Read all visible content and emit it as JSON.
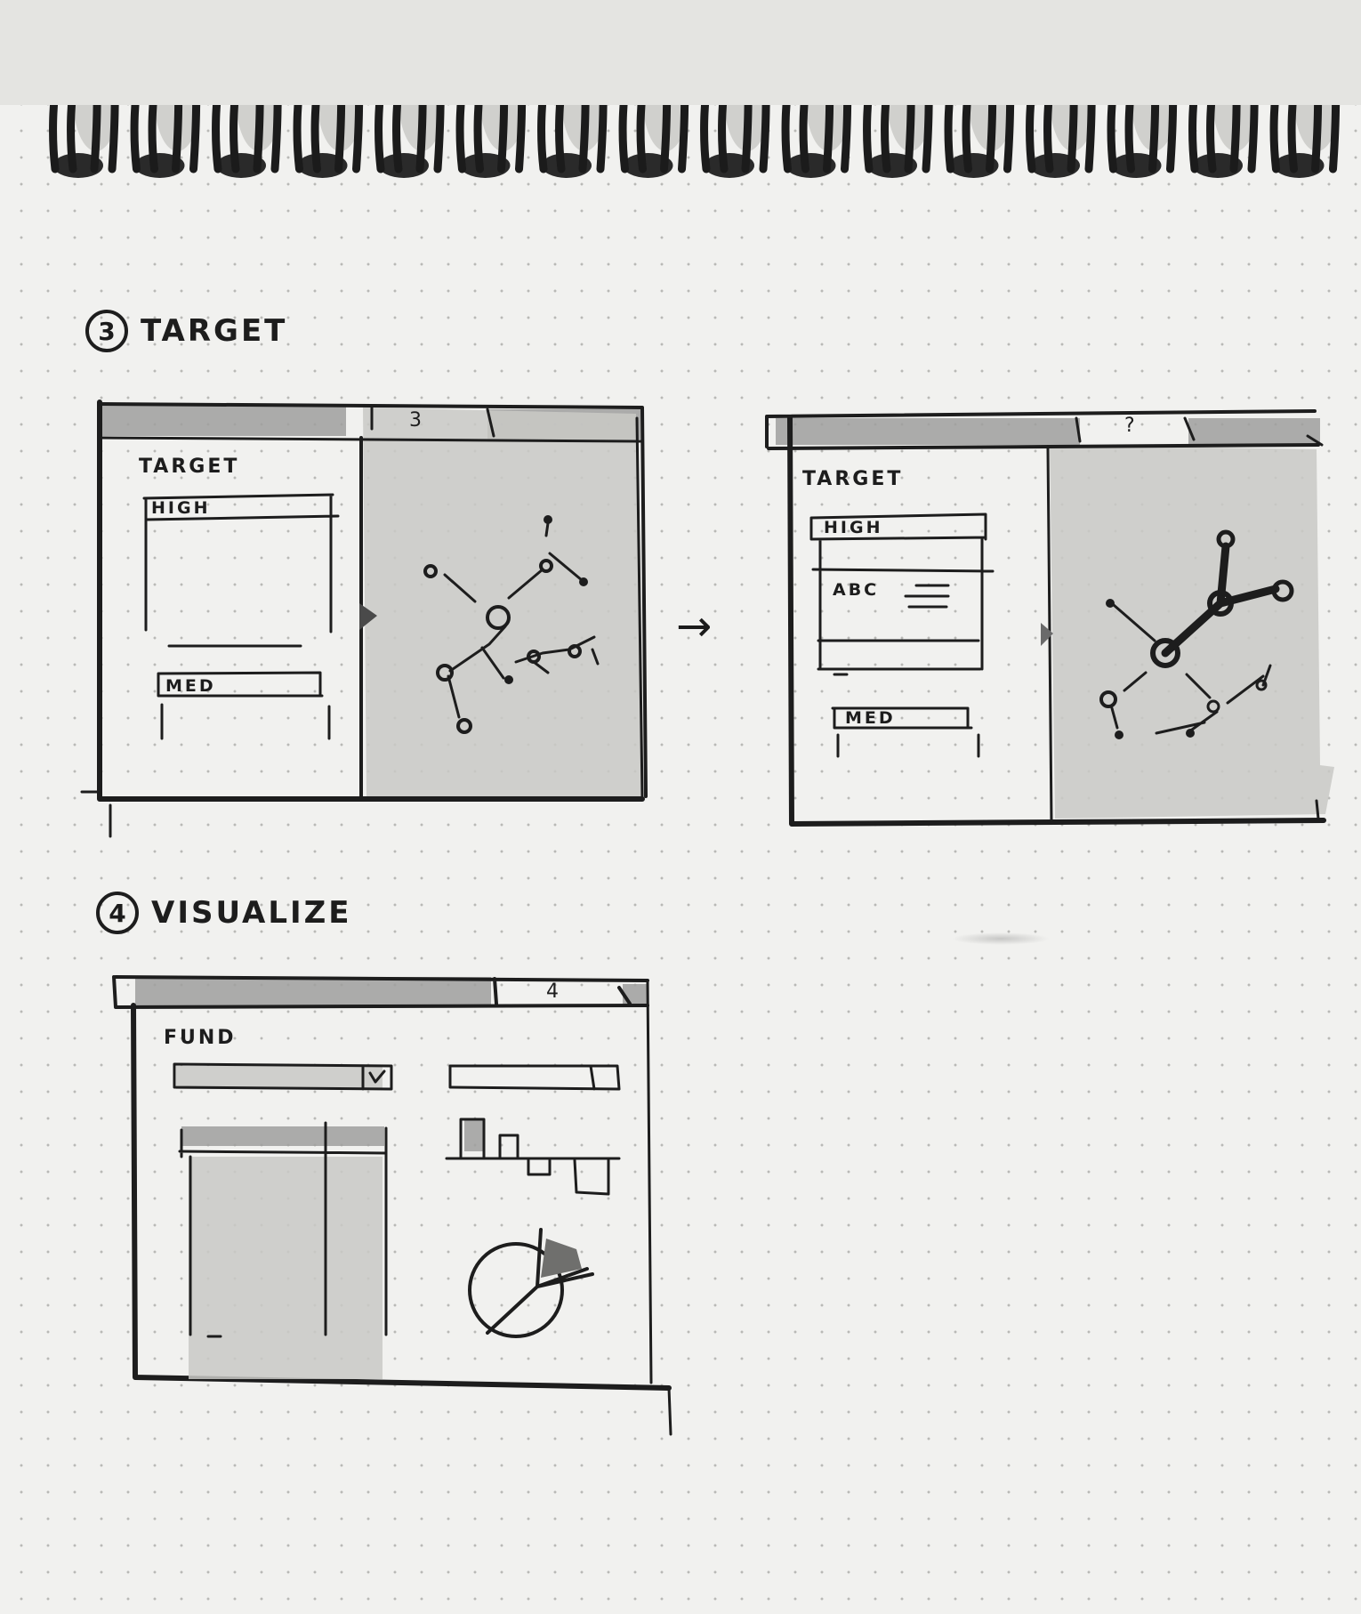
{
  "sections": [
    {
      "number": "3",
      "title": "TARGET",
      "sketches": [
        {
          "tab_number": "3",
          "panel_title": "TARGET",
          "fields": [
            "HIGH",
            "MED"
          ]
        },
        {
          "tab_number": "?",
          "panel_title": "TARGET",
          "fields": [
            "HIGH",
            "ABC",
            "MED"
          ]
        }
      ],
      "arrow": "→"
    },
    {
      "number": "4",
      "title": "VISUALIZE",
      "sketches": [
        {
          "tab_number": "4",
          "panel_title": "FUND"
        }
      ]
    }
  ],
  "palette": {
    "paper": "#f1f1ef",
    "ink": "#1d1d1d",
    "marker": "#9f9f9d",
    "marker_light": "#c9c9c6"
  }
}
